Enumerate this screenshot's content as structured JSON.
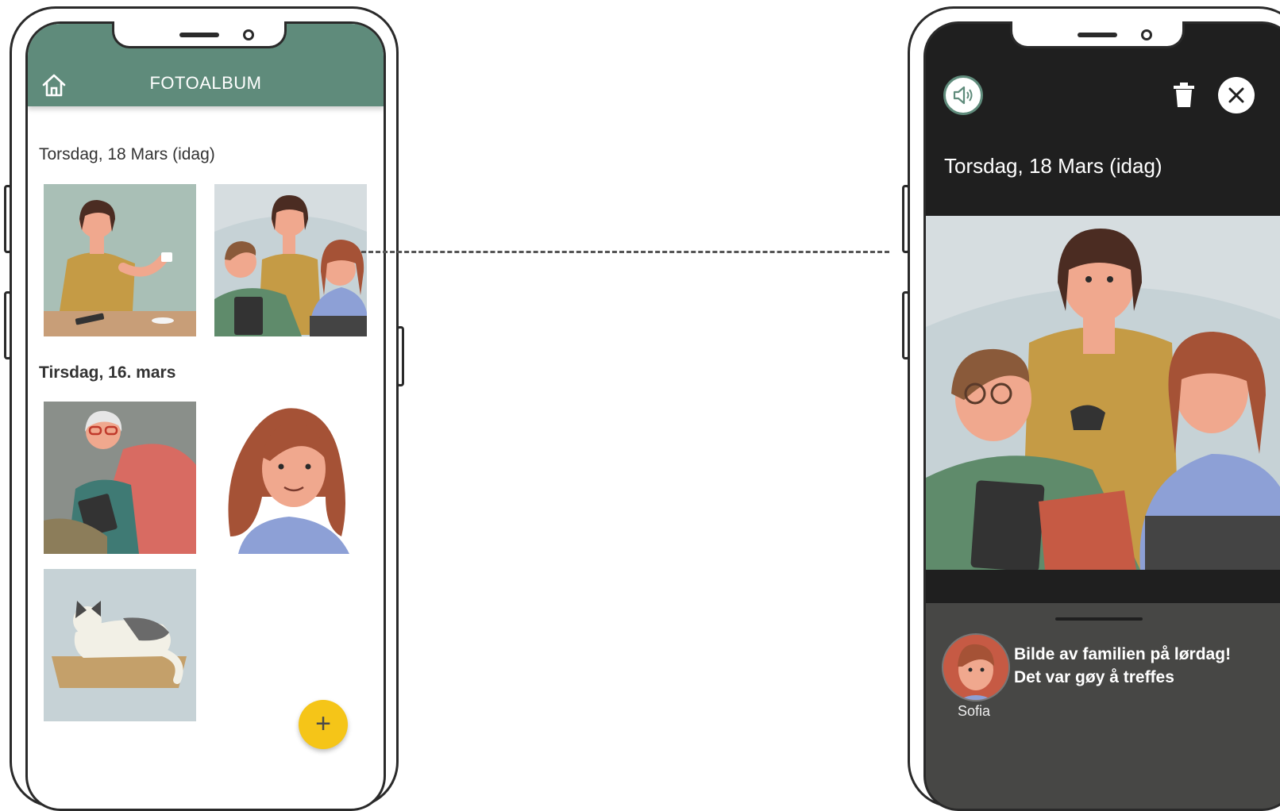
{
  "album": {
    "title": "FOTOALBUM",
    "sections": [
      {
        "date": "Torsdag, 18 Mars (idag)"
      },
      {
        "date": "Tirsdag, 16. mars"
      }
    ],
    "add_button": "+"
  },
  "viewer": {
    "date": "Torsdag, 18 Mars (idag)",
    "message_line1": "Bilde av familien på lørdag!",
    "message_line2": "Det var gøy å treffes",
    "author": "Sofia"
  },
  "colors": {
    "header_green": "#5f8b7b",
    "fab_yellow": "#f5c518",
    "viewer_bg": "#1f1f1f",
    "sheet_bg": "#474745"
  },
  "icons": [
    "home-icon",
    "plus-icon",
    "speaker-icon",
    "trash-icon",
    "close-icon"
  ]
}
